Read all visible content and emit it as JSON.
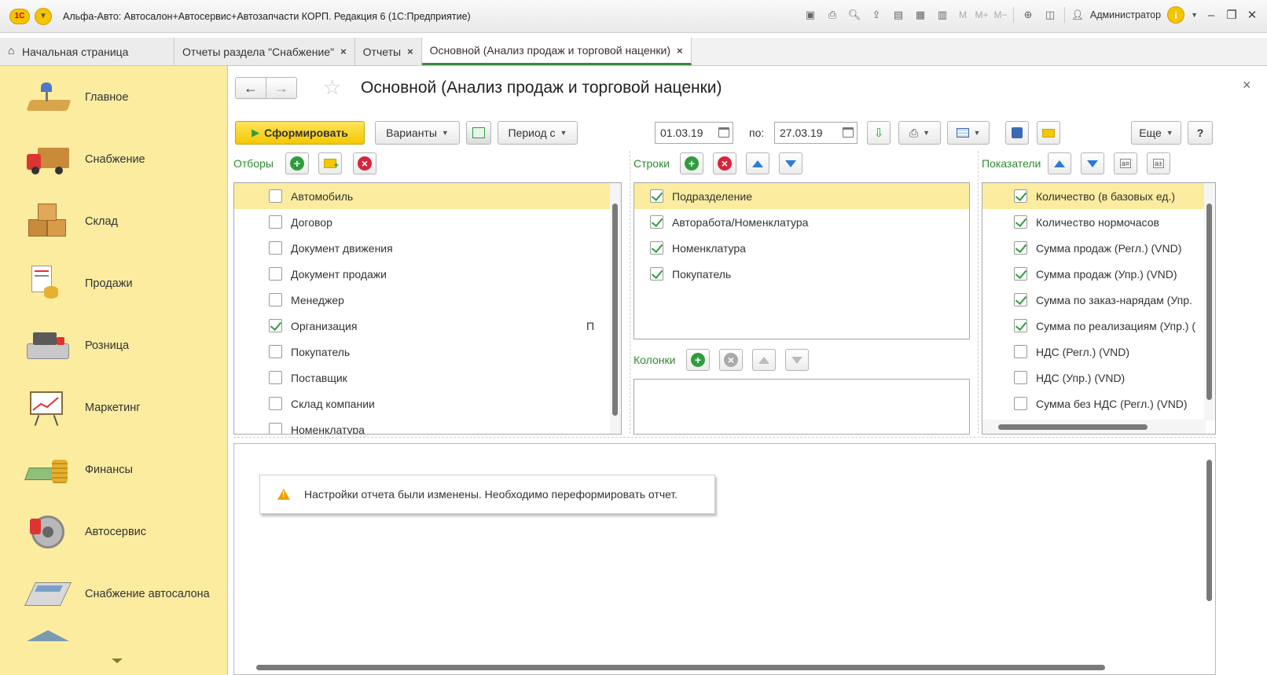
{
  "window": {
    "title": "Альфа-Авто: Автосалон+Автосервис+Автозапчасти КОРП. Редакция 6  (1С:Предприятие)",
    "logo": "1С",
    "user": "Администратор",
    "memory_labels": [
      "M",
      "M+",
      "M−"
    ]
  },
  "tabs": [
    {
      "label": "Начальная страница",
      "closable": false
    },
    {
      "label": "Отчеты раздела \"Снабжение\"",
      "closable": true
    },
    {
      "label": "Отчеты",
      "closable": true
    },
    {
      "label": "Основной (Анализ продаж и торговой наценки)",
      "closable": true,
      "active": true
    }
  ],
  "tab_close_glyph": "×",
  "sidebar": {
    "items": [
      {
        "label": "Главное",
        "icon": "desk-lamp-icon"
      },
      {
        "label": "Снабжение",
        "icon": "truck-icon"
      },
      {
        "label": "Склад",
        "icon": "boxes-icon"
      },
      {
        "label": "Продажи",
        "icon": "document-coins-icon"
      },
      {
        "label": "Розница",
        "icon": "cash-register-icon"
      },
      {
        "label": "Маркетинг",
        "icon": "chart-board-icon"
      },
      {
        "label": "Финансы",
        "icon": "money-stack-icon"
      },
      {
        "label": "Автосервис",
        "icon": "brake-disc-icon"
      },
      {
        "label": "Снабжение автосалона",
        "icon": "calculator-icon"
      }
    ]
  },
  "form": {
    "title": "Основной (Анализ продаж и торговой наценки)",
    "close_glyph": "×",
    "nav_back": "←",
    "nav_forward": "→",
    "star": "☆"
  },
  "toolbar": {
    "generate": "Сформировать",
    "variants": "Варианты",
    "period": "Период с",
    "date_from": "01.03.19",
    "to_label": "по:",
    "date_to": "27.03.19",
    "more": "Еще",
    "help": "?"
  },
  "filters": {
    "label": "Отборы",
    "items": [
      {
        "label": "Автомобиль",
        "checked": false,
        "selected": true,
        "note": ""
      },
      {
        "label": "Договор",
        "checked": false,
        "note": ""
      },
      {
        "label": "Документ движения",
        "checked": false,
        "note": ""
      },
      {
        "label": "Документ продажи",
        "checked": false,
        "note": ""
      },
      {
        "label": "Менеджер",
        "checked": false,
        "note": ""
      },
      {
        "label": "Организация",
        "checked": true,
        "note": "П"
      },
      {
        "label": "Покупатель",
        "checked": false,
        "note": ""
      },
      {
        "label": "Поставщик",
        "checked": false,
        "note": ""
      },
      {
        "label": "Склад компании",
        "checked": false,
        "note": ""
      },
      {
        "label": "Номенклатура",
        "checked": false,
        "note": ""
      }
    ]
  },
  "rows_section": {
    "label": "Строки",
    "items": [
      {
        "label": "Подразделение",
        "checked": true,
        "selected": true
      },
      {
        "label": "Авторабота/Номенклатура",
        "checked": true
      },
      {
        "label": "Номенклатура",
        "checked": true
      },
      {
        "label": "Покупатель",
        "checked": true
      }
    ]
  },
  "columns_section": {
    "label": "Колонки"
  },
  "indicators": {
    "label": "Показатели",
    "items": [
      {
        "label": "Количество (в базовых ед.)",
        "checked": true,
        "selected": true
      },
      {
        "label": "Количество нормочасов",
        "checked": true
      },
      {
        "label": "Сумма продаж (Регл.) (VND)",
        "checked": true
      },
      {
        "label": "Сумма продаж (Упр.) (VND)",
        "checked": true
      },
      {
        "label": "Сумма по заказ-нарядам (Упр.",
        "checked": true
      },
      {
        "label": "Сумма по реализациям (Упр.) (",
        "checked": true
      },
      {
        "label": "НДС (Регл.) (VND)",
        "checked": false
      },
      {
        "label": "НДС (Упр.) (VND)",
        "checked": false
      },
      {
        "label": "Сумма без НДС (Регл.) (VND)",
        "checked": false
      }
    ]
  },
  "message": "Настройки отчета были изменены. Необходимо переформировать отчет.",
  "colors": {
    "sidebar_bg": "#fbeca0",
    "accent_green": "#2e8b2e",
    "generate_btn": "#f4c800",
    "selection": "#fbeca0"
  }
}
